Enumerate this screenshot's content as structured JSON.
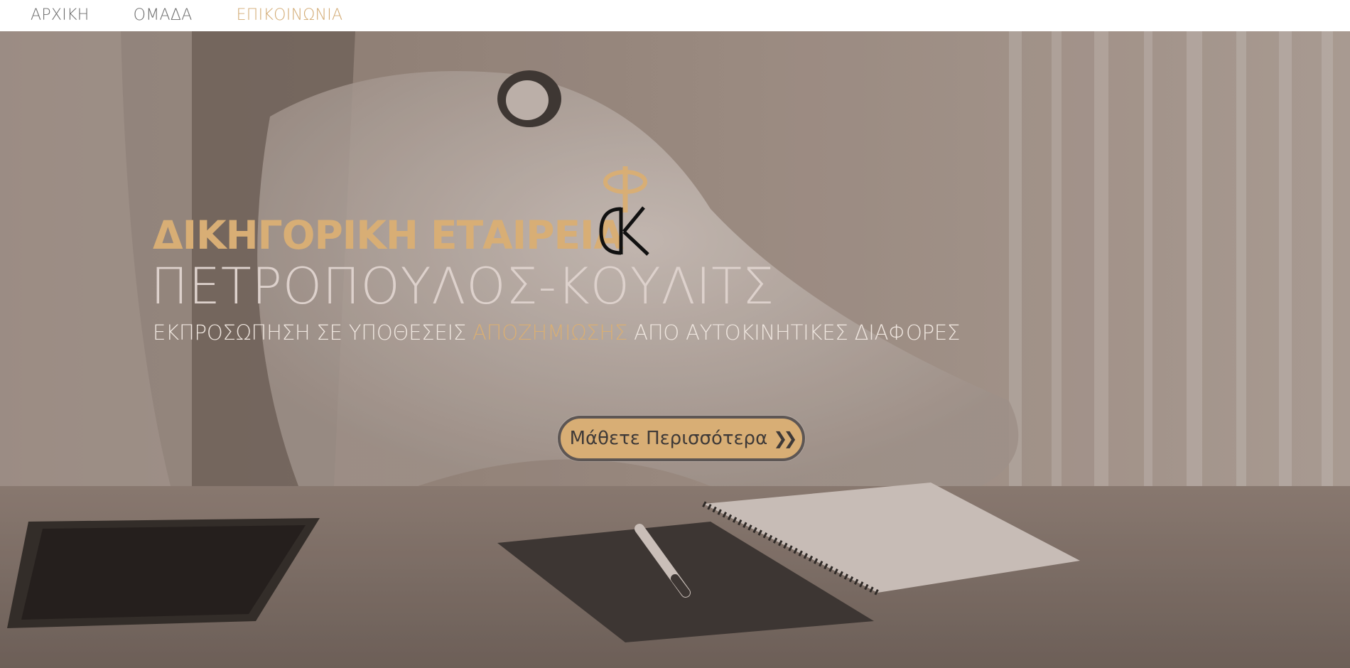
{
  "nav": {
    "items": [
      {
        "label": "ΑΡΧΙΚΗ",
        "active": false
      },
      {
        "label": "ΟΜΑΔΑ",
        "active": false
      },
      {
        "label": "ΕΠΙΚΟΙΝΩΝΙΑ",
        "active": true
      }
    ]
  },
  "hero": {
    "firm_type": "ΔΙΚΗΓΟΡΙΚΗ ΕΤΑΙΡΕΙΑ",
    "firm_name": "ΠΕΤΡΟΠΟΥΛΟΣ-ΚΟΥΛΙΤΣ",
    "tagline_before": "ΕΚΠΡΟΣΩΠΗΣΗ ΣΕ ΥΠΟΘΕΣΕΙΣ ",
    "tagline_highlight": "ΑΠΟΖΗΜΙΩΣΗΣ",
    "tagline_after": " ΑΠΟ ΑΥΤΟΚΙΝΗΤΙΚΕΣ ΔΙΑΦΟΡΕΣ",
    "cta_label": "Μάθετε Περισσότερα",
    "cta_icon": "double-chevron-right-icon",
    "logo": "phi-ck-monogram"
  },
  "colors": {
    "accent": "#d8ae75",
    "nav_text": "#6b6b6b",
    "hero_overlay": "#9a8b80"
  }
}
